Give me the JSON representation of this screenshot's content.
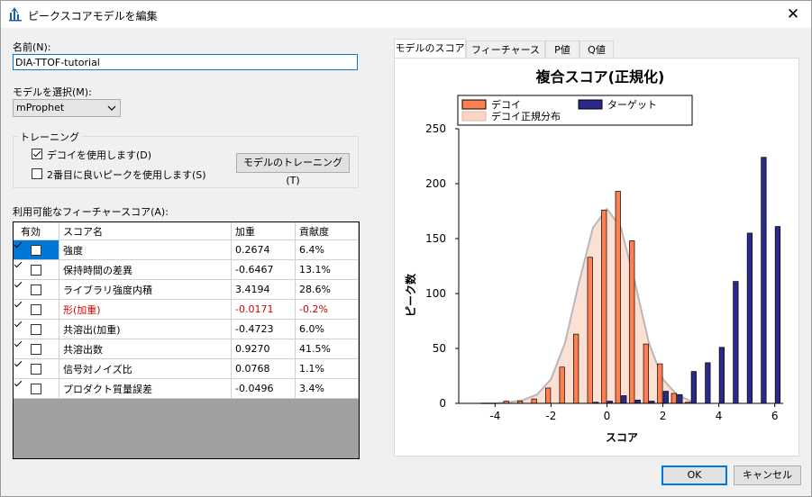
{
  "window": {
    "title": "ピークスコアモデルを編集",
    "close_glyph": "✕"
  },
  "form": {
    "name_label": "名前(N):",
    "name_value": "DIA-TTOF-tutorial",
    "model_label": "モデルを選択(M):",
    "model_value": "mProphet",
    "training_group": "トレーニング",
    "use_decoys_label": "デコイを使用します(D)",
    "use_decoys_checked": true,
    "use_second_best_label": "2番目に良いピークを使用します(S)",
    "use_second_best_checked": false,
    "train_button": "モデルのトレーニング(T)",
    "features_label": "利用可能なフィーチャースコア(A):"
  },
  "grid": {
    "columns": [
      "有効",
      "スコア名",
      "加重",
      "貢献度"
    ],
    "rows": [
      {
        "enabled": true,
        "name": "強度",
        "weight": "0.2674",
        "contribution": "6.4%"
      },
      {
        "enabled": true,
        "name": "保持時間の差異",
        "weight": "-0.6467",
        "contribution": "13.1%"
      },
      {
        "enabled": true,
        "name": "ライブラリ強度内積",
        "weight": "3.4194",
        "contribution": "28.6%"
      },
      {
        "enabled": true,
        "name": "形(加重)",
        "weight": "-0.0171",
        "contribution": "-0.2%",
        "negative": true
      },
      {
        "enabled": true,
        "name": "共溶出(加重)",
        "weight": "-0.4723",
        "contribution": "6.0%"
      },
      {
        "enabled": true,
        "name": "共溶出数",
        "weight": "0.9270",
        "contribution": "41.5%"
      },
      {
        "enabled": true,
        "name": "信号対ノイズ比",
        "weight": "0.0768",
        "contribution": "1.1%"
      },
      {
        "enabled": true,
        "name": "プロダクト質量誤差",
        "weight": "-0.0496",
        "contribution": "3.4%"
      }
    ]
  },
  "tabs": [
    {
      "label": "モデルのスコア",
      "active": true
    },
    {
      "label": "フィーチャースコア",
      "active": false
    },
    {
      "label": "P値",
      "active": false
    },
    {
      "label": "Q値",
      "active": false
    }
  ],
  "buttons": {
    "ok": "OK",
    "cancel": "キャンセル"
  },
  "colors": {
    "decoy": "#ff7f50",
    "target": "#2a2a8c",
    "decoy_normal": "#fcd5c5"
  },
  "chart_data": {
    "type": "bar",
    "title": "複合スコア(正規化)",
    "xlabel": "スコア",
    "ylabel": "ピーク数",
    "xlim": [
      -5.3,
      6.3
    ],
    "ylim": [
      0,
      250
    ],
    "xticks": [
      -4,
      -2,
      0,
      2,
      4,
      6
    ],
    "yticks": [
      0,
      50,
      100,
      150,
      200,
      250
    ],
    "grid": false,
    "legend_position": "top",
    "bin_centers": [
      -4.5,
      -4.0,
      -3.5,
      -3.0,
      -2.5,
      -2.0,
      -1.5,
      -1.0,
      -0.5,
      0.0,
      0.5,
      1.0,
      1.5,
      2.0,
      2.5,
      3.0,
      3.5,
      4.0,
      4.5,
      5.0,
      5.5,
      6.0
    ],
    "series": [
      {
        "name": "デコイ",
        "values": [
          0,
          0,
          2,
          2,
          4,
          14,
          33,
          63,
          133,
          176,
          193,
          148,
          54,
          36,
          9,
          1,
          0,
          0,
          0,
          0,
          0,
          0
        ]
      },
      {
        "name": "ターゲット",
        "values": [
          0,
          0,
          0,
          0,
          0,
          0,
          0,
          0,
          1,
          2,
          7,
          3,
          2,
          11,
          8,
          29,
          37,
          51,
          111,
          155,
          224,
          161
        ]
      }
    ],
    "normal_curve": {
      "name": "デコイ正規分布",
      "x": [
        -4.5,
        -4.0,
        -3.5,
        -3.0,
        -2.5,
        -2.0,
        -1.5,
        -1.0,
        -0.5,
        0.0,
        0.5,
        1.0,
        1.5,
        2.0,
        2.5,
        3.0
      ],
      "y": [
        0,
        0,
        1,
        3,
        8,
        22,
        55,
        110,
        160,
        177,
        160,
        110,
        55,
        22,
        8,
        2
      ]
    }
  }
}
